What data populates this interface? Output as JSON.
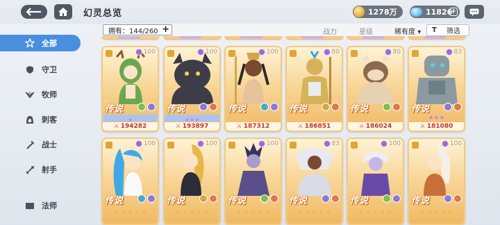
{
  "header": {
    "title": "幻灵总览",
    "gold": "1278万",
    "gems": "11826",
    "gem_plus": "+"
  },
  "sidebar": {
    "items": [
      {
        "label": "全部",
        "icon": "star-gear-icon",
        "active": true
      },
      {
        "label": "守卫",
        "icon": "shield-icon"
      },
      {
        "label": "牧师",
        "icon": "wings-icon"
      },
      {
        "label": "刺客",
        "icon": "hood-icon"
      },
      {
        "label": "战士",
        "icon": "axe-icon"
      },
      {
        "label": "射手",
        "icon": "bow-icon"
      },
      {
        "label": "法师",
        "icon": "book-icon"
      }
    ]
  },
  "toolbar": {
    "owned": "拥有：144/260",
    "owned_plus": "+",
    "sort_power": "战力",
    "sort_star": "星级",
    "sort_rarity": "稀有度",
    "sort_rarity_arrow": "▾",
    "filter_icon": "T",
    "filter": "筛选"
  },
  "heroes_row1": [
    {
      "level": "100",
      "rarity": "传说",
      "power": "194282",
      "accent": "#6aa84f",
      "stars": 1
    },
    {
      "level": "100",
      "rarity": "传说",
      "power": "193897",
      "accent": "#3d3d4a",
      "stars": 3
    },
    {
      "level": "100",
      "rarity": "传说",
      "power": "187312",
      "accent": "#e6c39a",
      "stars": 0
    },
    {
      "level": "80",
      "rarity": "传说",
      "power": "186851",
      "accent": "#d6b35a",
      "stars": 0
    },
    {
      "level": "80",
      "rarity": "传说",
      "power": "186024",
      "accent": "#8b6a50",
      "stars": 0
    },
    {
      "level": "83",
      "rarity": "传说",
      "power": "181080",
      "accent": "#8a9aa0",
      "stars": 3
    }
  ],
  "heroes_row2": [
    {
      "level": "100",
      "rarity": "传说",
      "accent": "#3fa9e8"
    },
    {
      "level": "100",
      "rarity": "传说",
      "accent": "#e6b84a"
    },
    {
      "level": "100",
      "rarity": "传说",
      "accent": "#5a4f8a"
    },
    {
      "level": "83",
      "rarity": "传说",
      "accent": "#e8e8f0"
    },
    {
      "level": "100",
      "rarity": "传说",
      "accent": "#6a4aa8"
    },
    {
      "level": "100",
      "rarity": "传说",
      "accent": "#c9703a"
    }
  ]
}
